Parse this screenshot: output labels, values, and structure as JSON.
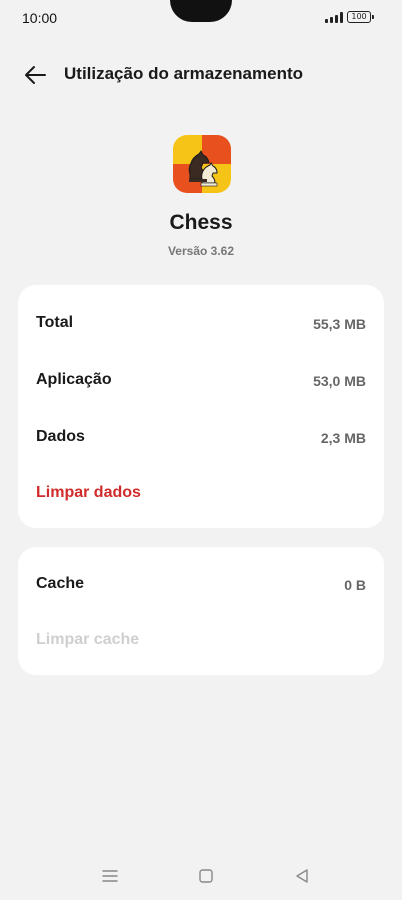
{
  "status_bar": {
    "time": "10:00",
    "battery": "100"
  },
  "header": {
    "title": "Utilização do armazenamento"
  },
  "app": {
    "name": "Chess",
    "version": "Versão 3.62"
  },
  "storage": {
    "total_label": "Total",
    "total_value": "55,3 MB",
    "app_label": "Aplicação",
    "app_value": "53,0 MB",
    "data_label": "Dados",
    "data_value": "2,3 MB",
    "clear_data": "Limpar dados"
  },
  "cache": {
    "label": "Cache",
    "value": "0 B",
    "clear_cache": "Limpar cache"
  },
  "colors": {
    "accent_red": "#d12b2b",
    "background": "#f2f2f2",
    "card": "#ffffff"
  }
}
